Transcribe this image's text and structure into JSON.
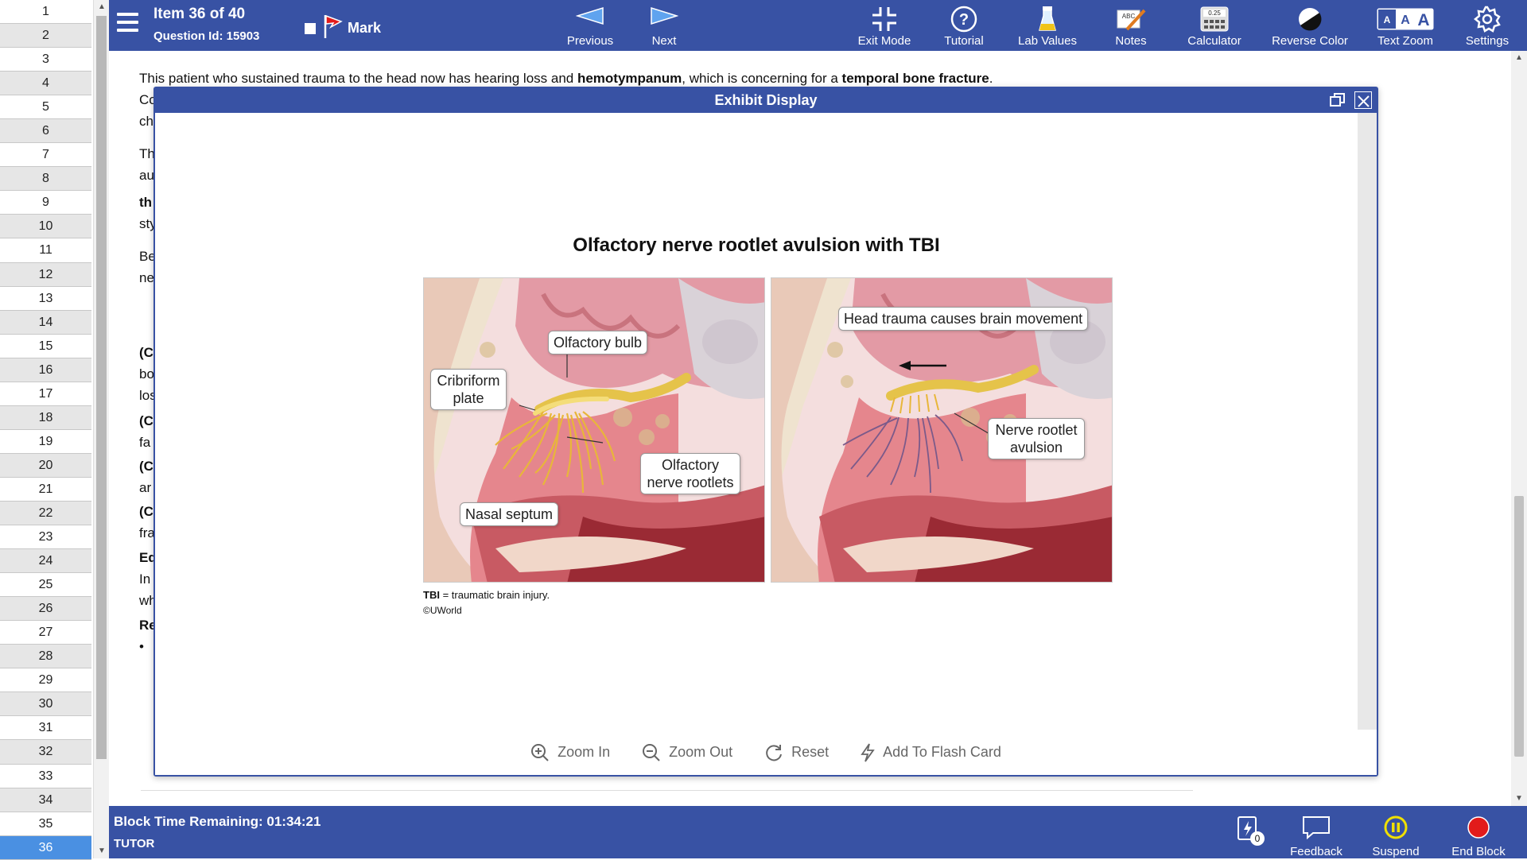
{
  "item_list": {
    "items": [
      "1",
      "2",
      "3",
      "4",
      "5",
      "6",
      "7",
      "8",
      "9",
      "10",
      "11",
      "12",
      "13",
      "14",
      "15",
      "16",
      "17",
      "18",
      "19",
      "20",
      "21",
      "22",
      "23",
      "24",
      "25",
      "26",
      "27",
      "28",
      "29",
      "30",
      "31",
      "32",
      "33",
      "34",
      "35",
      "36"
    ],
    "current": "36"
  },
  "header": {
    "item_title": "Item 36 of 40",
    "question_id": "Question Id: 15903",
    "mark_label": "Mark",
    "previous_label": "Previous",
    "next_label": "Next",
    "tools": {
      "exit_mode": "Exit Mode",
      "tutorial": "Tutorial",
      "lab_values": "Lab Values",
      "notes": "Notes",
      "calculator": "Calculator",
      "calculator_display": "0.25",
      "reverse_color": "Reverse Color",
      "text_zoom": "Text Zoom",
      "settings": "Settings"
    }
  },
  "content": {
    "intro_pre": "This patient who sustained trauma to the head now has hearing loss and ",
    "intro_b1": "hemotympanum",
    "intro_mid": ", which is concerning for a ",
    "intro_b2": "temporal bone fracture",
    "intro_end": ".",
    "fragments": [
      "Co",
      "ch",
      "Th",
      "au",
      "th",
      "sty",
      "Be",
      "ne",
      "(C",
      "bo",
      "los",
      "(C",
      "fa",
      "(C",
      "ar",
      "(C",
      "fra",
      "Ed",
      "In",
      "wh",
      "Re",
      "•"
    ]
  },
  "exhibit": {
    "header": "Exhibit Display",
    "figure_title": "Olfactory nerve rootlet avulsion with TBI",
    "labels": {
      "olfactory_bulb": "Olfactory bulb",
      "cribriform_plate": "Cribriform plate",
      "olfactory_nerve_rootlets": "Olfactory nerve rootlets",
      "nasal_septum": "Nasal septum",
      "head_trauma": "Head trauma causes brain movement",
      "nerve_rootlet_avulsion": "Nerve rootlet avulsion"
    },
    "footnote_abbr": "TBI",
    "footnote_text": " = traumatic brain injury.",
    "copyright": "©UWorld",
    "toolbar": {
      "zoom_in": "Zoom In",
      "zoom_out": "Zoom Out",
      "reset": "Reset",
      "add_flash_card": "Add To Flash Card"
    }
  },
  "footer": {
    "time_remaining": "Block Time Remaining: 01:34:21",
    "mode": "TUTOR",
    "flashcard_count": "0",
    "feedback": "Feedback",
    "suspend": "Suspend",
    "end_block": "End Block"
  },
  "colors": {
    "brand_blue": "#3852a4",
    "current_item": "#4a90e2",
    "suspend_yellow": "#f0e000",
    "end_red": "#e21b1b"
  }
}
